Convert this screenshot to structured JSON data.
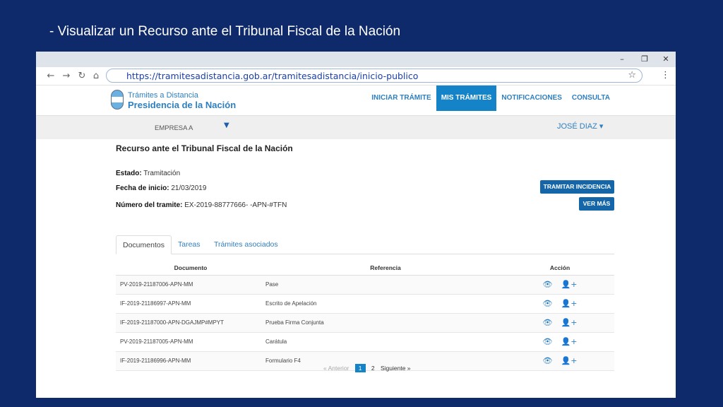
{
  "slide": {
    "title": "- Visualizar un Recurso ante el Tribunal Fiscal de la Nación"
  },
  "browser": {
    "url": "https://tramitesadistancia.gob.ar/tramitesadistancia/inicio-publico",
    "window_controls": [
      "–",
      "❐",
      "✕"
    ],
    "nav_icons": [
      "←",
      "→",
      "↻",
      "⌂"
    ]
  },
  "site": {
    "logo_line1": "Trámites a Distancia",
    "logo_line2": "Presidencia de la Nación",
    "nav": [
      "INICIAR TRÁMITE",
      "MIS TRÁMITES",
      "NOTIFICACIONES",
      "CONSULTA"
    ],
    "active_nav": "MIS TRÁMITES",
    "company": "EMPRESA A",
    "user": "JOSÉ DIAZ ▾"
  },
  "tramite": {
    "title": "Recurso ante el Tribunal Fiscal de la Nación",
    "estado_label": "Estado:",
    "estado_value": "Tramitación",
    "fecha_label": "Fecha de inicio:",
    "fecha_value": "21/03/2019",
    "numero_label": "Número del tramite:",
    "numero_value": "EX-2019-88777666- -APN-#TFN",
    "btn_incidencia": "TRAMITAR INCIDENCIA",
    "btn_ver_mas": "VER MÁS"
  },
  "tabs": [
    "Documentos",
    "Tareas",
    "Trámites asociados"
  ],
  "table": {
    "headers": [
      "Documento",
      "Referencia",
      "Acción"
    ],
    "rows": [
      {
        "documento": "PV-2019-21187006-APN-MM",
        "referencia": "Pase"
      },
      {
        "documento": "IF-2019-21186997-APN-MM",
        "referencia": "Escrito de Apelación"
      },
      {
        "documento": "IF-2019-21187000-APN-DGAJMP#MPYT",
        "referencia": "Prueba Firma Conjunta"
      },
      {
        "documento": "PV-2019-21187005-APN-MM",
        "referencia": "Carátula"
      },
      {
        "documento": "IF-2019-21186996-APN-MM",
        "referencia": "Formulario F4"
      }
    ]
  },
  "pagination": {
    "prev": "« Anterior",
    "pages": [
      "1",
      "2"
    ],
    "current": "1",
    "next": "Siguiente »"
  },
  "colors": {
    "slide_bg": "#0f2a6b",
    "accent": "#1583c7",
    "button": "#1566a8"
  }
}
